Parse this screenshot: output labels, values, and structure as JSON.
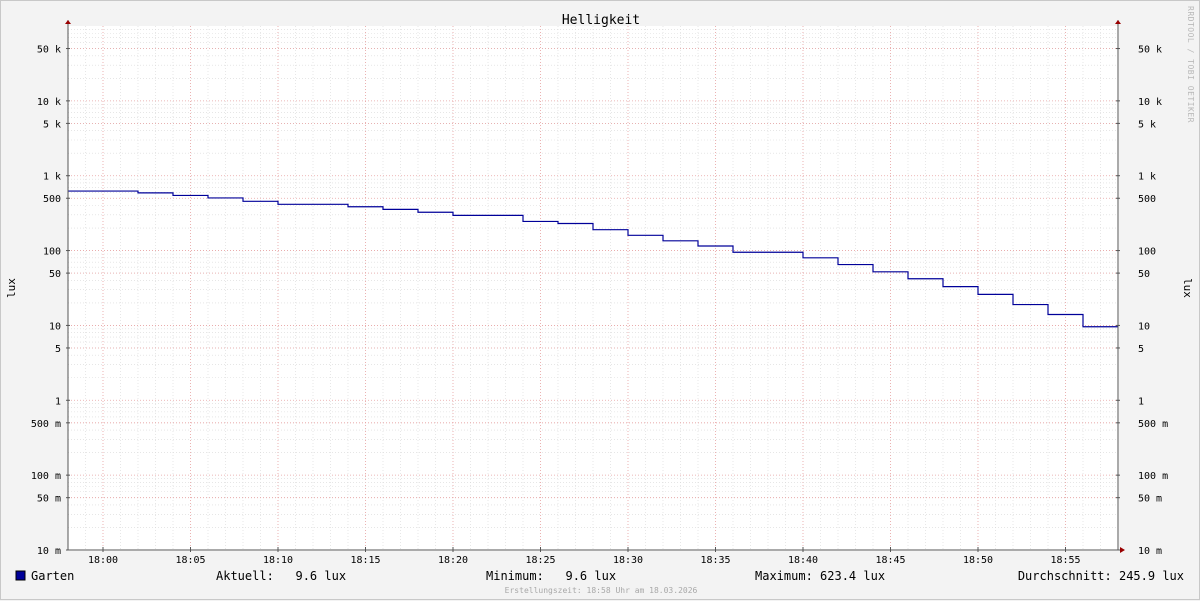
{
  "chart_data": {
    "type": "line",
    "title": "Helligkeit",
    "ylabel": "lux",
    "y_scale": "log",
    "ylim": [
      0.01,
      100000
    ],
    "y_ticks": [
      {
        "value": 0.01,
        "label": "10 m"
      },
      {
        "value": 0.05,
        "label": "50 m"
      },
      {
        "value": 0.1,
        "label": "100 m"
      },
      {
        "value": 0.5,
        "label": "500 m"
      },
      {
        "value": 1,
        "label": "1"
      },
      {
        "value": 5,
        "label": "5"
      },
      {
        "value": 10,
        "label": "10"
      },
      {
        "value": 50,
        "label": "50"
      },
      {
        "value": 100,
        "label": "100"
      },
      {
        "value": 500,
        "label": "500"
      },
      {
        "value": 1000,
        "label": "1 k"
      },
      {
        "value": 5000,
        "label": "5 k"
      },
      {
        "value": 10000,
        "label": "10 k"
      },
      {
        "value": 50000,
        "label": "50 k"
      }
    ],
    "x_ticks": [
      "18:00",
      "18:05",
      "18:10",
      "18:15",
      "18:20",
      "18:25",
      "18:30",
      "18:35",
      "18:40",
      "18:45",
      "18:50",
      "18:55"
    ],
    "xlim": [
      "17:58",
      "18:58"
    ],
    "grid": true,
    "series": [
      {
        "name": "Garten",
        "color": "#000099",
        "step": true,
        "x": [
          "17:58",
          "18:02",
          "18:04",
          "18:06",
          "18:08",
          "18:10",
          "18:14",
          "18:16",
          "18:18",
          "18:20",
          "18:24",
          "18:26",
          "18:28",
          "18:30",
          "18:32",
          "18:34",
          "18:36",
          "18:40",
          "18:42",
          "18:44",
          "18:46",
          "18:48",
          "18:50",
          "18:52",
          "18:54",
          "18:56",
          "18:58"
        ],
        "values": [
          623.4,
          590,
          545,
          505,
          455,
          415,
          385,
          355,
          325,
          295,
          245,
          230,
          190,
          160,
          135,
          115,
          95,
          80,
          65,
          52,
          42,
          33,
          26,
          19,
          14,
          9.6,
          9.6
        ]
      }
    ]
  },
  "watermark": "RRDTOOL / TOBI OETIKER",
  "legend": {
    "label": "Garten",
    "color": "#000099",
    "aktuell": "Aktuell:   9.6 lux",
    "minimum": "Minimum:   9.6 lux",
    "maximum": "Maximum: 623.4 lux",
    "durchschnitt": "Durchschnitt: 245.9 lux"
  },
  "footer": "Erstellungszeit: 18:58 Uhr am 18.03.2026"
}
